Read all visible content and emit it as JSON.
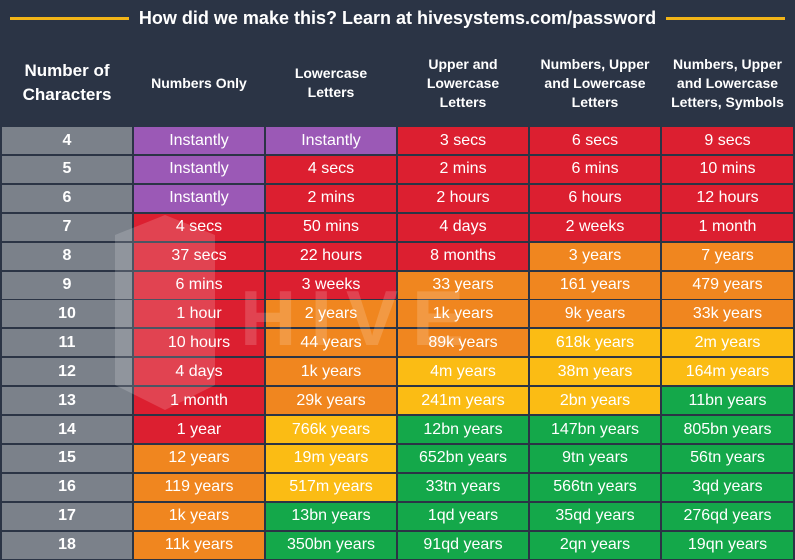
{
  "banner": {
    "text": "How did we make this? Learn at hivesystems.com/password"
  },
  "watermark": {
    "text": "HIVE SYSTEMS"
  },
  "colors": {
    "purple": "#9b59b6",
    "red": "#dc1f30",
    "orange": "#f0861f",
    "yellow": "#fbbc14",
    "green": "#14a84a",
    "gray": "#7b818a",
    "background": "#2b3445",
    "accent": "#f2b417"
  },
  "chart_data": {
    "type": "table",
    "columns": [
      "Number of Characters",
      "Numbers Only",
      "Lowercase Letters",
      "Upper and Lowercase Letters",
      "Numbers, Upper and Lowercase Letters",
      "Numbers, Upper and Lowercase Letters, Symbols"
    ],
    "rows": [
      {
        "chars": "4",
        "cells": [
          [
            "Instantly",
            "purple"
          ],
          [
            "Instantly",
            "purple"
          ],
          [
            "3 secs",
            "red"
          ],
          [
            "6 secs",
            "red"
          ],
          [
            "9 secs",
            "red"
          ]
        ]
      },
      {
        "chars": "5",
        "cells": [
          [
            "Instantly",
            "purple"
          ],
          [
            "4 secs",
            "red"
          ],
          [
            "2 mins",
            "red"
          ],
          [
            "6 mins",
            "red"
          ],
          [
            "10 mins",
            "red"
          ]
        ]
      },
      {
        "chars": "6",
        "cells": [
          [
            "Instantly",
            "purple"
          ],
          [
            "2 mins",
            "red"
          ],
          [
            "2 hours",
            "red"
          ],
          [
            "6 hours",
            "red"
          ],
          [
            "12 hours",
            "red"
          ]
        ]
      },
      {
        "chars": "7",
        "cells": [
          [
            "4 secs",
            "red"
          ],
          [
            "50 mins",
            "red"
          ],
          [
            "4 days",
            "red"
          ],
          [
            "2 weeks",
            "red"
          ],
          [
            "1 month",
            "red"
          ]
        ]
      },
      {
        "chars": "8",
        "cells": [
          [
            "37 secs",
            "red"
          ],
          [
            "22 hours",
            "red"
          ],
          [
            "8 months",
            "red"
          ],
          [
            "3 years",
            "orange"
          ],
          [
            "7 years",
            "orange"
          ]
        ]
      },
      {
        "chars": "9",
        "cells": [
          [
            "6 mins",
            "red"
          ],
          [
            "3 weeks",
            "red"
          ],
          [
            "33 years",
            "orange"
          ],
          [
            "161 years",
            "orange"
          ],
          [
            "479 years",
            "orange"
          ]
        ]
      },
      {
        "chars": "10",
        "cells": [
          [
            "1 hour",
            "red"
          ],
          [
            "2 years",
            "orange"
          ],
          [
            "1k years",
            "orange"
          ],
          [
            "9k years",
            "orange"
          ],
          [
            "33k years",
            "orange"
          ]
        ]
      },
      {
        "chars": "11",
        "cells": [
          [
            "10 hours",
            "red"
          ],
          [
            "44 years",
            "orange"
          ],
          [
            "89k years",
            "orange"
          ],
          [
            "618k years",
            "yellow"
          ],
          [
            "2m years",
            "yellow"
          ]
        ]
      },
      {
        "chars": "12",
        "cells": [
          [
            "4 days",
            "red"
          ],
          [
            "1k years",
            "orange"
          ],
          [
            "4m years",
            "yellow"
          ],
          [
            "38m years",
            "yellow"
          ],
          [
            "164m years",
            "yellow"
          ]
        ]
      },
      {
        "chars": "13",
        "cells": [
          [
            "1 month",
            "red"
          ],
          [
            "29k years",
            "orange"
          ],
          [
            "241m years",
            "yellow"
          ],
          [
            "2bn years",
            "yellow"
          ],
          [
            "11bn years",
            "green"
          ]
        ]
      },
      {
        "chars": "14",
        "cells": [
          [
            "1 year",
            "red"
          ],
          [
            "766k years",
            "yellow"
          ],
          [
            "12bn years",
            "green"
          ],
          [
            "147bn years",
            "green"
          ],
          [
            "805bn years",
            "green"
          ]
        ]
      },
      {
        "chars": "15",
        "cells": [
          [
            "12 years",
            "orange"
          ],
          [
            "19m years",
            "yellow"
          ],
          [
            "652bn years",
            "green"
          ],
          [
            "9tn years",
            "green"
          ],
          [
            "56tn years",
            "green"
          ]
        ]
      },
      {
        "chars": "16",
        "cells": [
          [
            "119 years",
            "orange"
          ],
          [
            "517m years",
            "yellow"
          ],
          [
            "33tn years",
            "green"
          ],
          [
            "566tn years",
            "green"
          ],
          [
            "3qd years",
            "green"
          ]
        ]
      },
      {
        "chars": "17",
        "cells": [
          [
            "1k years",
            "orange"
          ],
          [
            "13bn years",
            "green"
          ],
          [
            "1qd years",
            "green"
          ],
          [
            "35qd years",
            "green"
          ],
          [
            "276qd years",
            "green"
          ]
        ]
      },
      {
        "chars": "18",
        "cells": [
          [
            "11k years",
            "orange"
          ],
          [
            "350bn years",
            "green"
          ],
          [
            "91qd years",
            "green"
          ],
          [
            "2qn years",
            "green"
          ],
          [
            "19qn years",
            "green"
          ]
        ]
      }
    ]
  }
}
